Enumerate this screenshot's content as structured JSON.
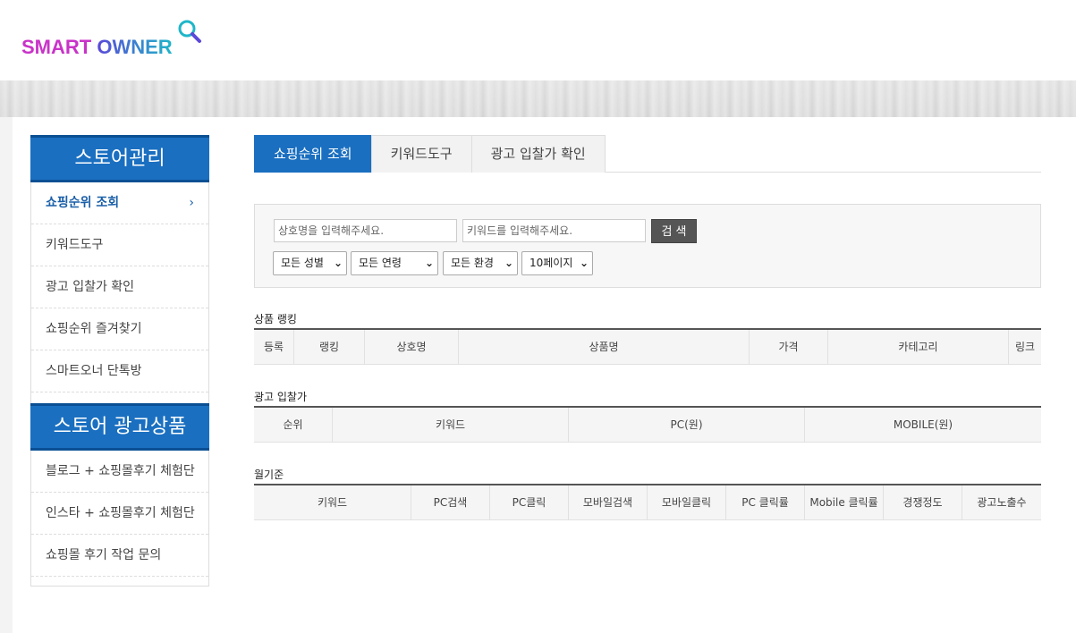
{
  "logo": {
    "smart": "SMART",
    "owner": "OWNER"
  },
  "sidebar": {
    "section1_title": "스토어관리",
    "items1": [
      {
        "label": "쇼핑순위 조회"
      },
      {
        "label": "키워드도구"
      },
      {
        "label": "광고 입찰가 확인"
      },
      {
        "label": "쇼핑순위 즐겨찾기"
      },
      {
        "label": "스마트오너 단톡방"
      }
    ],
    "active_chevron": "›",
    "section2_title": "스토어 광고상품",
    "items2": [
      {
        "label": "블로그 + 쇼핑몰후기 체험단"
      },
      {
        "label": "인스타 + 쇼핑몰후기 체험단"
      },
      {
        "label": "쇼핑몰 후기 작업 문의"
      }
    ]
  },
  "tabs": [
    {
      "label": "쇼핑순위 조회"
    },
    {
      "label": "키워드도구"
    },
    {
      "label": "광고 입찰가 확인"
    }
  ],
  "search": {
    "store_placeholder": "상호명을 입력해주세요.",
    "keyword_placeholder": "키워드를 입력해주세요.",
    "button": "검 색",
    "gender": "모든 성별",
    "age": "모든 연령",
    "env": "모든 환경",
    "pages": "10페이지"
  },
  "ranking": {
    "title": "상품 랭킹",
    "columns": [
      "등록",
      "랭킹",
      "상호명",
      "상품명",
      "가격",
      "카테고리",
      "링크"
    ]
  },
  "bid": {
    "title": "광고 입찰가",
    "columns": [
      "순위",
      "키워드",
      "PC(원)",
      "MOBILE(원)"
    ]
  },
  "monthly": {
    "title": "월기준",
    "columns": [
      "키워드",
      "PC검색",
      "PC클릭",
      "모바일검색",
      "모바일클릭",
      "PC 클릭률",
      "Mobile 클릭률",
      "경쟁정도",
      "광고노출수"
    ]
  },
  "colors": {
    "primary": "#1a6fc0",
    "logo_magenta": "#c933c9",
    "logo_teal": "#1fb6c8"
  }
}
